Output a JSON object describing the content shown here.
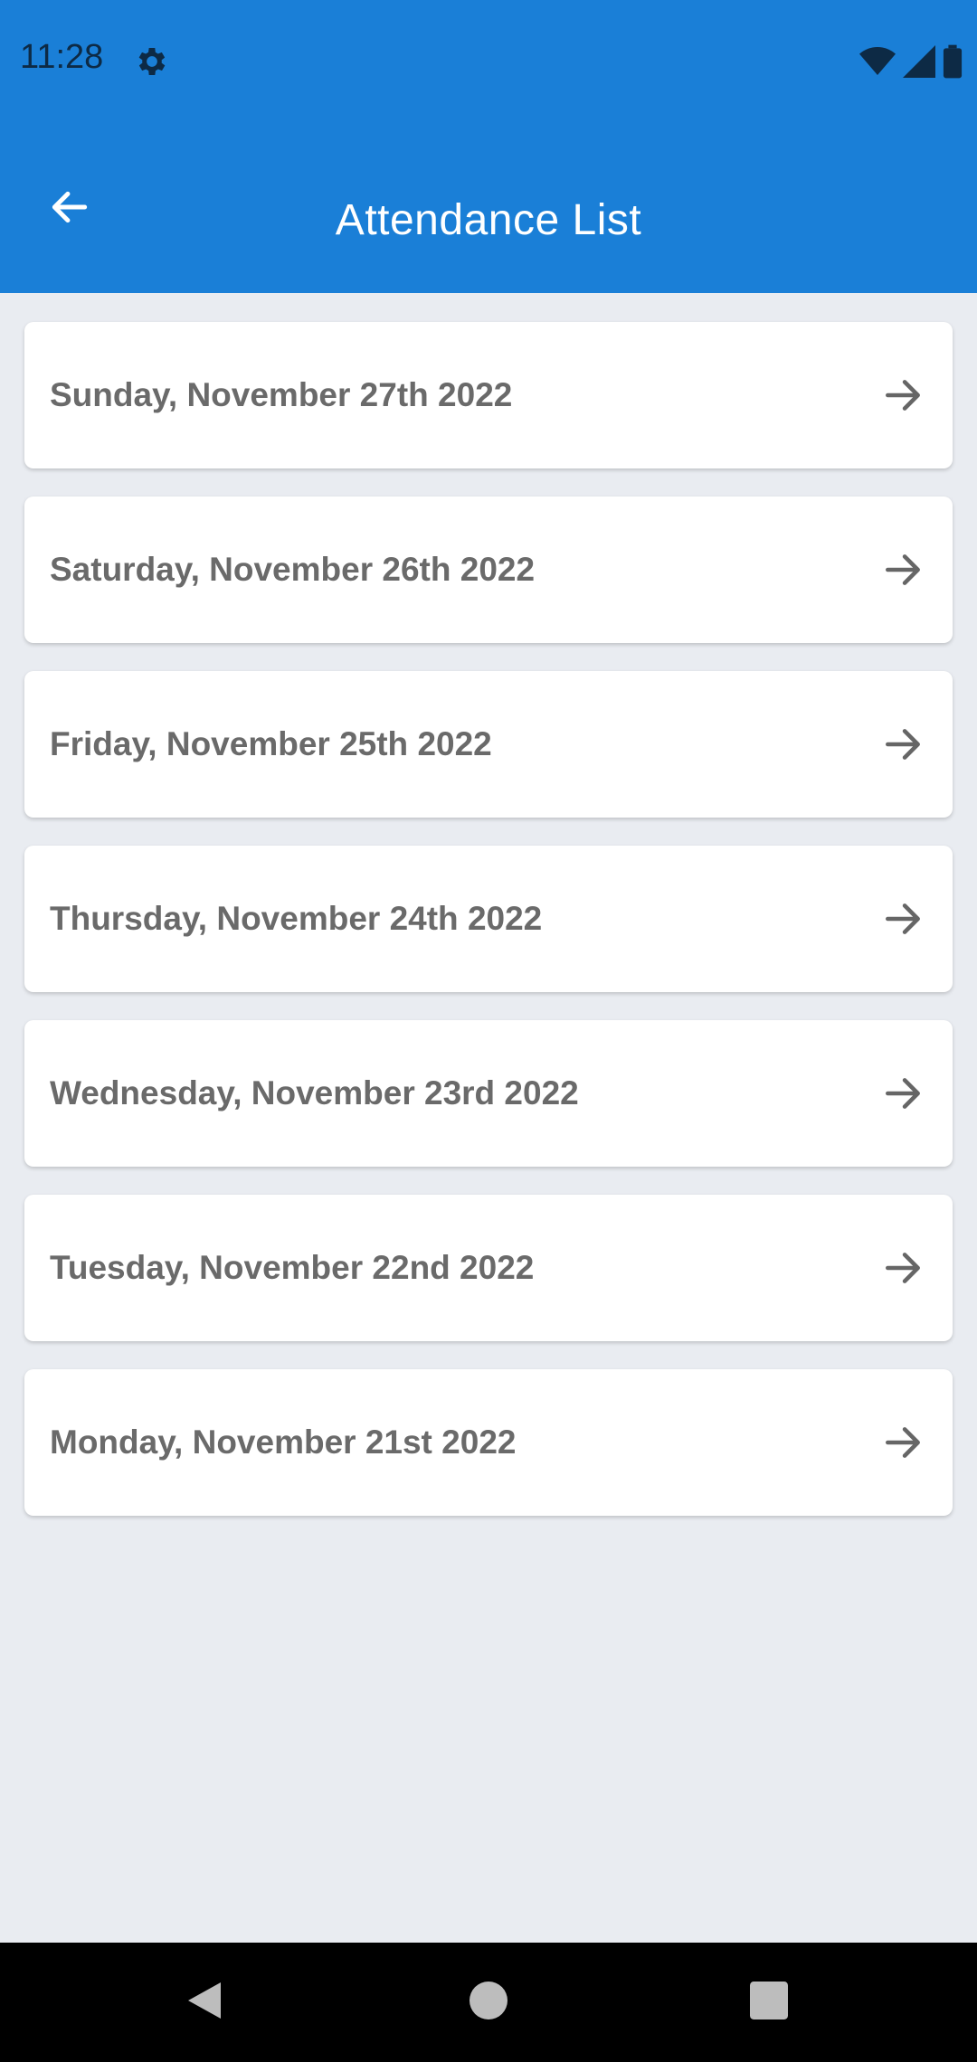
{
  "status_bar": {
    "time": "11:28",
    "icons": [
      "gear-icon",
      "wifi-icon",
      "cellular-signal-icon",
      "battery-icon"
    ]
  },
  "app_bar": {
    "title": "Attendance List",
    "back_icon": "arrow-left-icon"
  },
  "attendance_items": [
    {
      "label": "Sunday, November 27th 2022",
      "icon": "arrow-right-icon"
    },
    {
      "label": "Saturday, November 26th 2022",
      "icon": "arrow-right-icon"
    },
    {
      "label": "Friday, November 25th 2022",
      "icon": "arrow-right-icon"
    },
    {
      "label": "Thursday, November 24th 2022",
      "icon": "arrow-right-icon"
    },
    {
      "label": "Wednesday, November 23rd 2022",
      "icon": "arrow-right-icon"
    },
    {
      "label": "Tuesday, November 22nd 2022",
      "icon": "arrow-right-icon"
    },
    {
      "label": "Monday, November 21st 2022",
      "icon": "arrow-right-icon"
    }
  ],
  "nav_bar": {
    "buttons": [
      "back-triangle-icon",
      "home-circle-icon",
      "recents-square-icon"
    ]
  },
  "colors": {
    "primary": "#1a7fd7",
    "background": "#e9ecf1",
    "card": "#ffffff",
    "item_text": "#6a6a6a"
  }
}
